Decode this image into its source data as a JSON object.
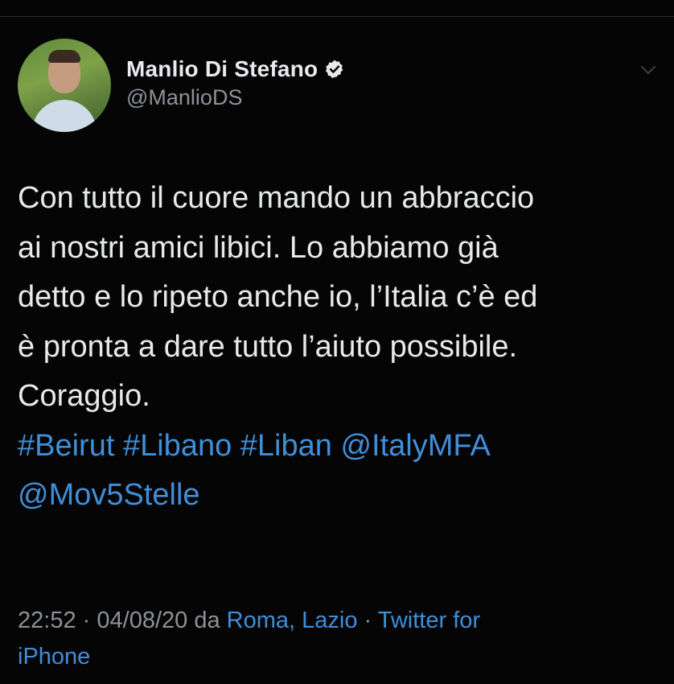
{
  "author": {
    "display_name": "Manlio Di Stefano",
    "handle": "@ManlioDS"
  },
  "tweet": {
    "lines": [
      "Con tutto il cuore mando un abbraccio",
      "ai nostri amici libici. Lo abbiamo già",
      "detto e lo ripeto anche io, l’Italia c’è ed",
      "è pronta a dare tutto l’aiuto possibile.",
      "Coraggio."
    ],
    "tags_line1": [
      "#Beirut",
      "#Libano",
      "#Liban",
      "@ItalyMFA"
    ],
    "tags_line2": [
      "@Mov5Stelle"
    ]
  },
  "meta": {
    "time": "22:52",
    "separator": "·",
    "date": "04/08/20",
    "da": "da",
    "location": "Roma, Lazio",
    "source_part1": "Twitter for",
    "source_part2": "iPhone"
  },
  "colors": {
    "background": "#050505",
    "text": "#e7e9ea",
    "muted": "#8b9299",
    "link": "#3f8ed8"
  },
  "icons": {
    "verified": "verified-badge-icon",
    "menu": "chevron-down-icon"
  }
}
